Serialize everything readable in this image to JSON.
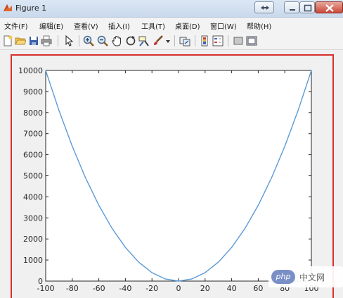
{
  "window": {
    "title": "Figure 1"
  },
  "menu": [
    "文件(F)",
    "编辑(E)",
    "查看(V)",
    "插入(I)",
    "工具(T)",
    "桌面(D)",
    "窗口(W)",
    "帮助(H)"
  ],
  "toolbar": {
    "icons": [
      "new-figure-icon",
      "open-file-icon",
      "save-icon",
      "print-icon",
      "pointer-icon",
      "zoom-in-icon",
      "zoom-out-icon",
      "pan-icon",
      "rotate-3d-icon",
      "data-cursor-icon",
      "brush-icon",
      "dropdown-arrow-icon",
      "link-plot-icon",
      "insert-colorbar-icon",
      "insert-legend-icon",
      "hide-plot-tools-icon",
      "show-plot-tools-icon"
    ]
  },
  "watermark": {
    "badge": "php",
    "text": "中文网"
  },
  "colors": {
    "line": "#5b9bd5",
    "highlight": "#d9302b"
  },
  "chart_data": {
    "type": "line",
    "x": [
      -100,
      -90,
      -80,
      -70,
      -60,
      -50,
      -40,
      -30,
      -20,
      -10,
      0,
      10,
      20,
      30,
      40,
      50,
      60,
      70,
      80,
      90,
      100
    ],
    "series": [
      {
        "values": [
          10000,
          8100,
          6400,
          4900,
          3600,
          2500,
          1600,
          900,
          400,
          100,
          0,
          100,
          400,
          900,
          1600,
          2500,
          3600,
          4900,
          6400,
          8100,
          10000
        ]
      }
    ],
    "xlim": [
      -100,
      100
    ],
    "ylim": [
      0,
      10000
    ],
    "xticks": [
      -100,
      -80,
      -60,
      -40,
      -20,
      0,
      20,
      40,
      60,
      80,
      100
    ],
    "yticks": [
      0,
      1000,
      2000,
      3000,
      4000,
      5000,
      6000,
      7000,
      8000,
      9000,
      10000
    ],
    "grid": false
  }
}
